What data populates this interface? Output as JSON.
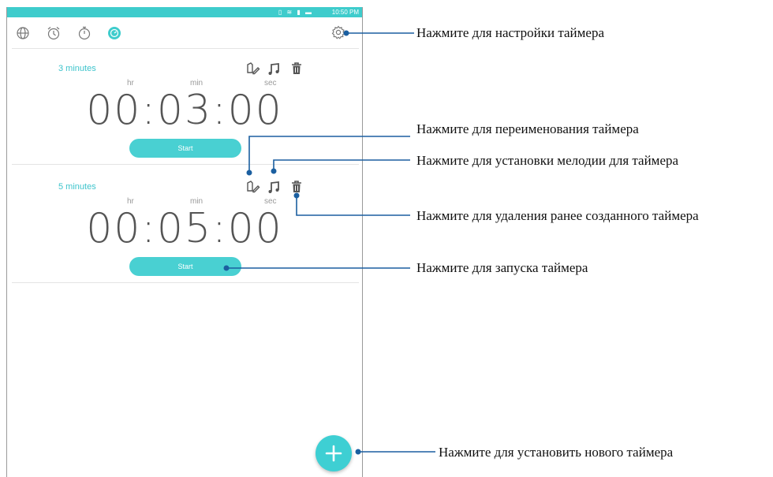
{
  "status_bar": {
    "icons": "▯ ≋ ▮ ▬",
    "time": "10:50 PM"
  },
  "tabs": [
    {
      "name": "world-clock",
      "icon": "globe-icon"
    },
    {
      "name": "alarm",
      "icon": "alarm-clock-icon"
    },
    {
      "name": "stopwatch",
      "icon": "stopwatch-icon"
    },
    {
      "name": "timer",
      "icon": "timer-icon",
      "active": true
    }
  ],
  "units": {
    "hr": "hr",
    "min": "min",
    "sec": "sec"
  },
  "timers": [
    {
      "name": "3 minutes",
      "time": "00:03:00",
      "start_label": "Start"
    },
    {
      "name": "5 minutes",
      "time": "00:05:00",
      "start_label": "Start"
    }
  ],
  "fab": {
    "icon": "plus-icon"
  },
  "callouts": {
    "settings": "Нажмите для настройки таймера",
    "rename": "Нажмите для переименования таймера",
    "ringtone": "Нажмите для установки мелодии для таймера",
    "delete": "Нажмите для удаления ранее созданного таймера",
    "start": "Нажмите для запуска таймера",
    "add": "Нажмите для установить нового таймера"
  },
  "colors": {
    "accent": "#3ECCCC",
    "callout_line": "#1B5FA0",
    "text": "#555555"
  }
}
